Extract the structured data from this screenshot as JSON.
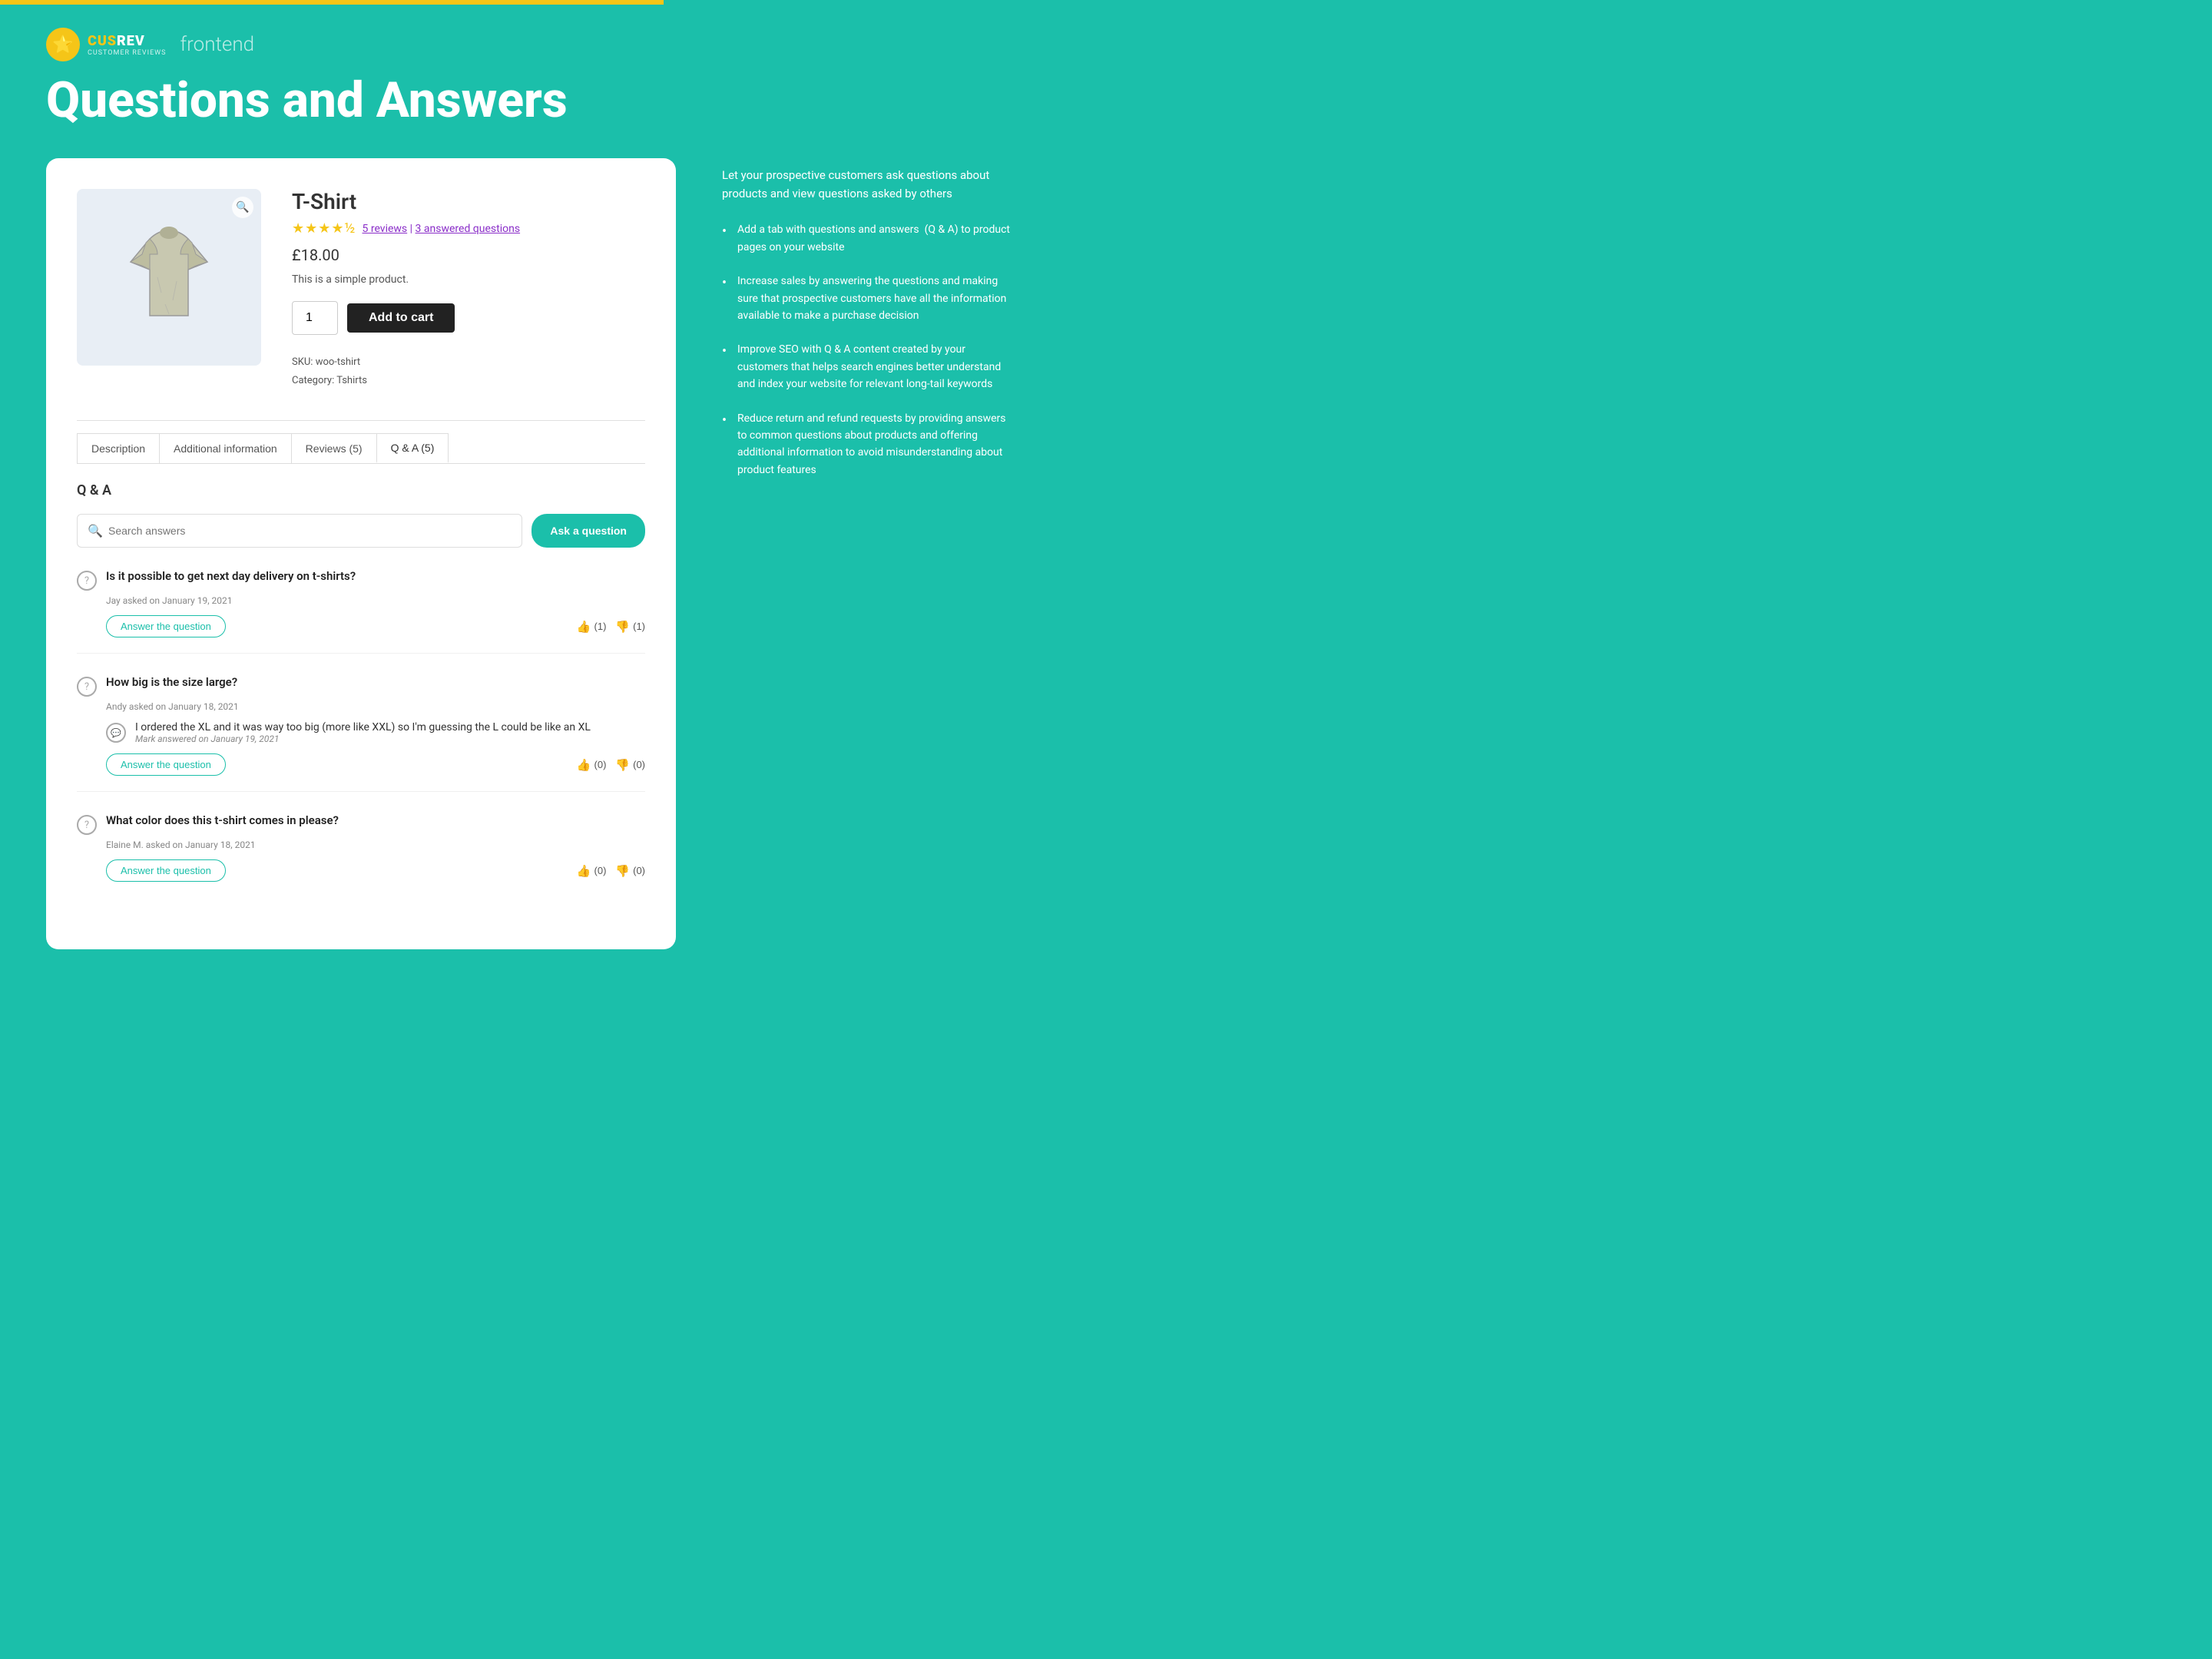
{
  "topBar": {},
  "header": {
    "logoName": "CUSREV",
    "logoCus": "CUS",
    "logoRev": "REV",
    "logoSub": "CUSTOMER REVIEWS",
    "frontend": "frontend",
    "pageTitle": "Questions and Answers"
  },
  "product": {
    "title": "T-Shirt",
    "price": "£18.00",
    "description": "This is a simple product.",
    "reviewCount": "5 reviews",
    "answeredQuestions": "3 answered questions",
    "skuLabel": "SKU:",
    "skuValue": "woo-tshirt",
    "categoryLabel": "Category:",
    "categoryValue": "Tshirts",
    "qtyValue": "1",
    "addToCartLabel": "Add to cart"
  },
  "tabs": [
    {
      "label": "Description",
      "active": false
    },
    {
      "label": "Additional information",
      "active": false
    },
    {
      "label": "Reviews (5)",
      "active": false
    },
    {
      "label": "Q & A (5)",
      "active": true
    }
  ],
  "qa": {
    "sectionTitle": "Q & A",
    "searchPlaceholder": "Search answers",
    "askButtonLabel": "Ask a question",
    "questions": [
      {
        "id": 1,
        "question": "Is it possible to get next day delivery on t-shirts?",
        "askedBy": "Jay asked on January 19, 2021",
        "answers": [],
        "answerBtnLabel": "Answer the question",
        "upvotes": "(1)",
        "downvotes": "(1)"
      },
      {
        "id": 2,
        "question": "How big is the size large?",
        "askedBy": "Andy asked on January 18, 2021",
        "answers": [
          {
            "text": "I ordered the XL and it was way too big (more like XXL) so I'm guessing the L could be like an XL",
            "answeredBy": "Mark answered on January 19, 2021"
          }
        ],
        "answerBtnLabel": "Answer the question",
        "upvotes": "(0)",
        "downvotes": "(0)"
      },
      {
        "id": 3,
        "question": "What color does this t-shirt comes in please?",
        "askedBy": "Elaine M. asked on January 18, 2021",
        "answers": [],
        "answerBtnLabel": "Answer the question",
        "upvotes": "(0)",
        "downvotes": "(0)"
      }
    ]
  },
  "sidebar": {
    "intro": "Let your prospective customers ask questions about products and view questions asked by others",
    "bullets": [
      "Add a tab with questions and answers  (Q & A) to product pages on your website",
      "Increase sales by answering the questions and making sure that prospective customers have all the information available to make a purchase decision",
      "Improve SEO with Q & A content created by your customers that helps search engines better understand and index your website for relevant long-tail keywords",
      "Reduce return and refund requests by providing answers to common questions about products and offering additional information to avoid misunderstanding about product features"
    ]
  },
  "colors": {
    "teal": "#1bbfaa",
    "dark": "#222222",
    "purple": "#8b2fc9",
    "yellow": "#f5c518"
  }
}
